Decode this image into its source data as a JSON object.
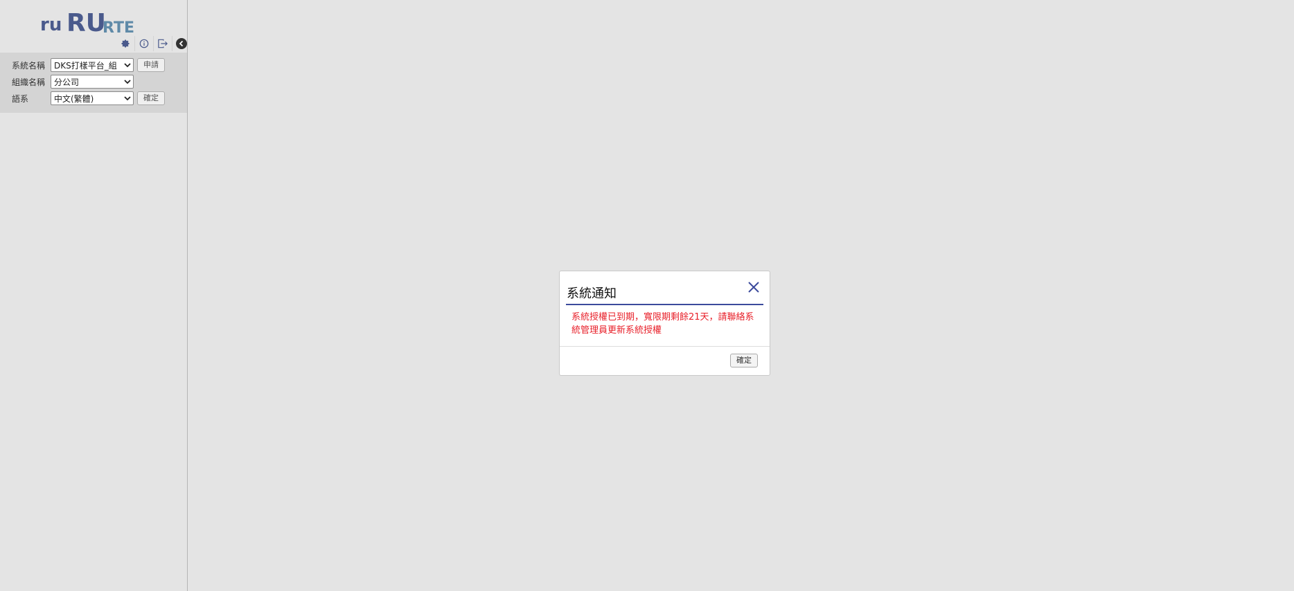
{
  "logo": {
    "part1": "ru",
    "part2": "RU",
    "part3": "RTE"
  },
  "toolbar": {
    "icons": [
      "gear-icon",
      "info-icon",
      "logout-icon",
      "collapse-icon"
    ]
  },
  "settings": {
    "system_name": {
      "label": "系統名稱",
      "value": "DKS打樣平台_組",
      "button": "申請"
    },
    "org_name": {
      "label": "組織名稱",
      "value": "分公司"
    },
    "language": {
      "label": "語系",
      "value": "中文(繁體)",
      "button": "確定"
    }
  },
  "dialog": {
    "title": "系統通知",
    "message": "系統授權已到期，寬限期剩餘21天，請聯絡系統管理員更新系統授權",
    "ok_label": "確定"
  },
  "colors": {
    "logo_dark": "#4a5a8c",
    "logo_light": "#5f8aa8",
    "accent": "#3b4a9c",
    "warning_text": "#e8202a"
  }
}
